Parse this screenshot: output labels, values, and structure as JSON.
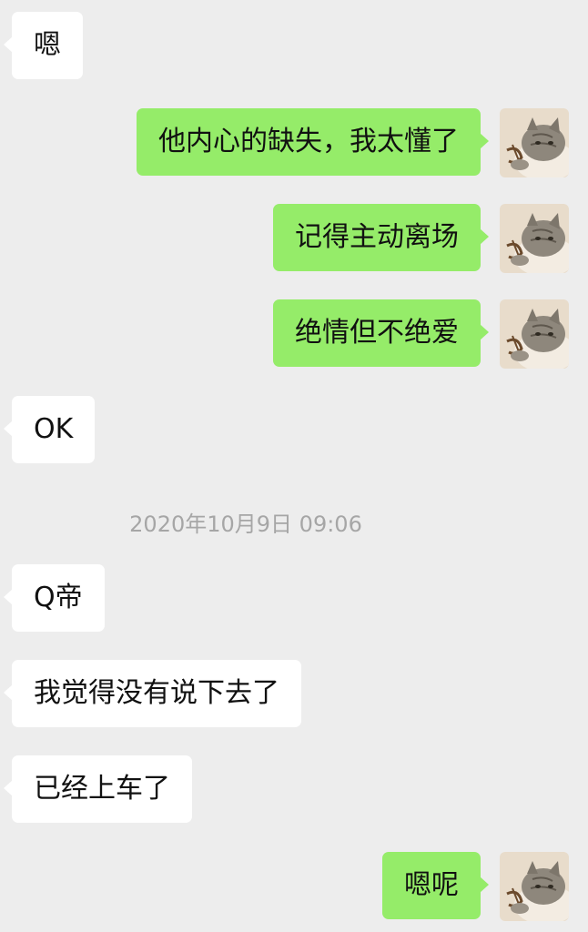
{
  "messages": [
    {
      "side": "in",
      "text": "嗯"
    },
    {
      "side": "out",
      "text": "他内心的缺失，我太懂了"
    },
    {
      "side": "out",
      "text": "记得主动离场"
    },
    {
      "side": "out",
      "text": "绝情但不绝爱"
    },
    {
      "side": "in",
      "text": "OK"
    },
    {
      "side": "in",
      "text": "Q帝"
    },
    {
      "side": "in",
      "text": "我觉得没有说下去了"
    },
    {
      "side": "in",
      "text": "已经上车了"
    },
    {
      "side": "out",
      "text": "嗯呢"
    }
  ],
  "timestamp": "2020年10月9日 09:06",
  "colors": {
    "background": "#ededed",
    "incoming_bubble": "#ffffff",
    "outgoing_bubble": "#95ec69",
    "timestamp_text": "#a6a6a6"
  },
  "avatar": {
    "icon": "cat-avatar-icon"
  }
}
